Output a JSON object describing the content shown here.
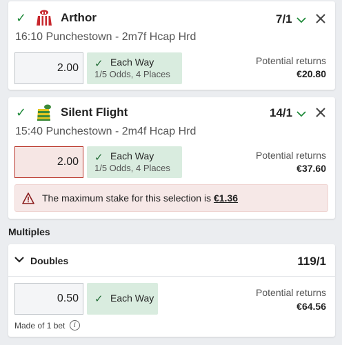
{
  "selections": [
    {
      "runner": "Arthor",
      "odds": "7/1",
      "race": "16:10 Punchestown - 2m7f Hcap Hrd",
      "stake": "2.00",
      "each_way_label": "Each Way",
      "each_way_terms": "1/5 Odds, 4 Places",
      "returns_label": "Potential returns",
      "returns_value": "€20.80",
      "silk_icon": "silk-red-white-icon"
    },
    {
      "runner": "Silent Flight",
      "odds": "14/1",
      "race": "15:40 Punchestown - 2m4f Hcap Hrd",
      "stake": "2.00",
      "each_way_label": "Each Way",
      "each_way_terms": "1/5 Odds, 4 Places",
      "returns_label": "Potential returns",
      "returns_value": "€37.60",
      "warning_text": "The maximum stake for this selection is",
      "warning_amount": "€1.36",
      "silk_icon": "silk-green-yellow-icon"
    }
  ],
  "multiples": {
    "section_title": "Multiples",
    "bet_type": "Doubles",
    "odds": "119/1",
    "stake": "0.50",
    "each_way_label": "Each Way",
    "returns_label": "Potential returns",
    "returns_value": "€64.56",
    "made_of": "Made of 1 bet"
  },
  "colors": {
    "accent_green": "#1f8a3a",
    "each_way_bg": "#d9ecdf",
    "error_red": "#b83227",
    "warning_bg": "#f6e8e7"
  }
}
